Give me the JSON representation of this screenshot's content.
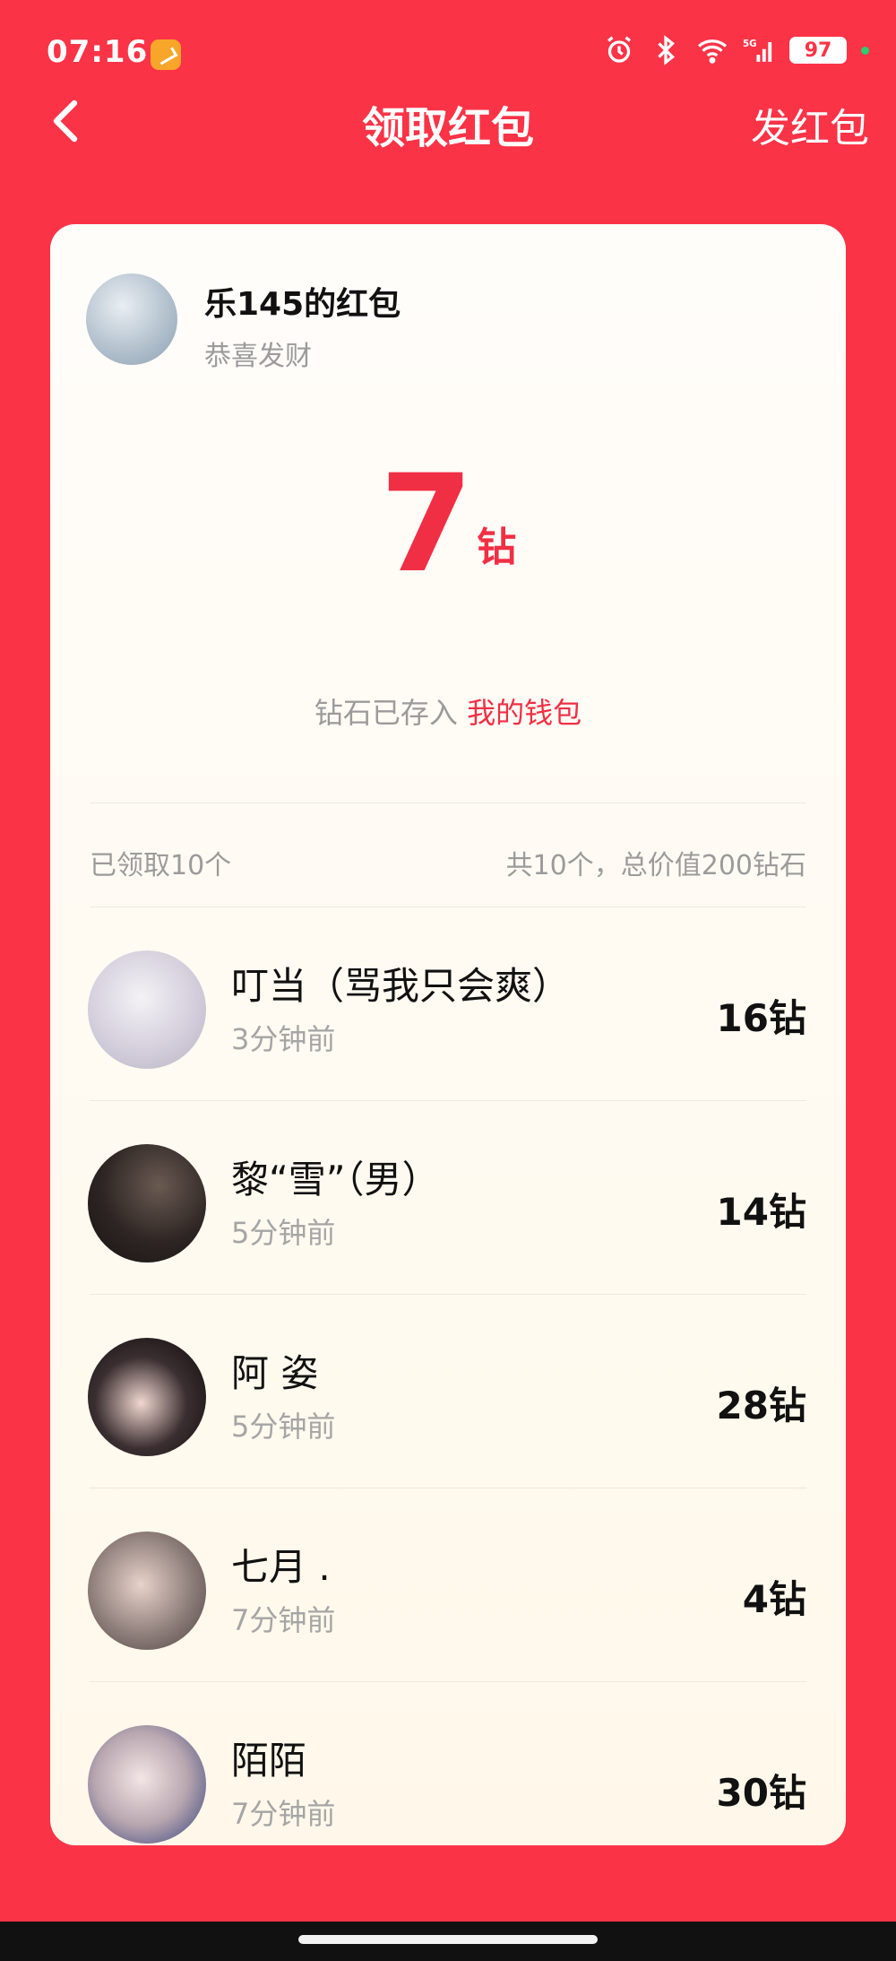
{
  "status_bar": {
    "time": "07:16",
    "network": "5G",
    "battery": "97"
  },
  "nav": {
    "title": "领取红包",
    "send_label": "发红包"
  },
  "packet": {
    "sender_name": "乐145的红包",
    "greeting": "恭喜发财",
    "amount": "7",
    "unit": "钻",
    "note_prefix": "钻石已存入",
    "wallet_link": "我的钱包"
  },
  "summary": {
    "claimed": "已领取10个",
    "total": "共10个，总价值200钻石"
  },
  "records": [
    {
      "name": "叮当（骂我只会爽）",
      "time": "3分钟前",
      "amount": "16钻"
    },
    {
      "name": "黎“雪”（男）",
      "time": "5分钟前",
      "amount": "14钻"
    },
    {
      "name": "阿 姿",
      "time": "5分钟前",
      "amount": "28钻"
    },
    {
      "name": "七月 .",
      "time": "7分钟前",
      "amount": "4钻"
    },
    {
      "name": "陌陌",
      "time": "7分钟前",
      "amount": "30钻"
    }
  ],
  "colors": {
    "background": "#FB3347",
    "accent": "#F02F45",
    "card": "#FFF8EA"
  }
}
